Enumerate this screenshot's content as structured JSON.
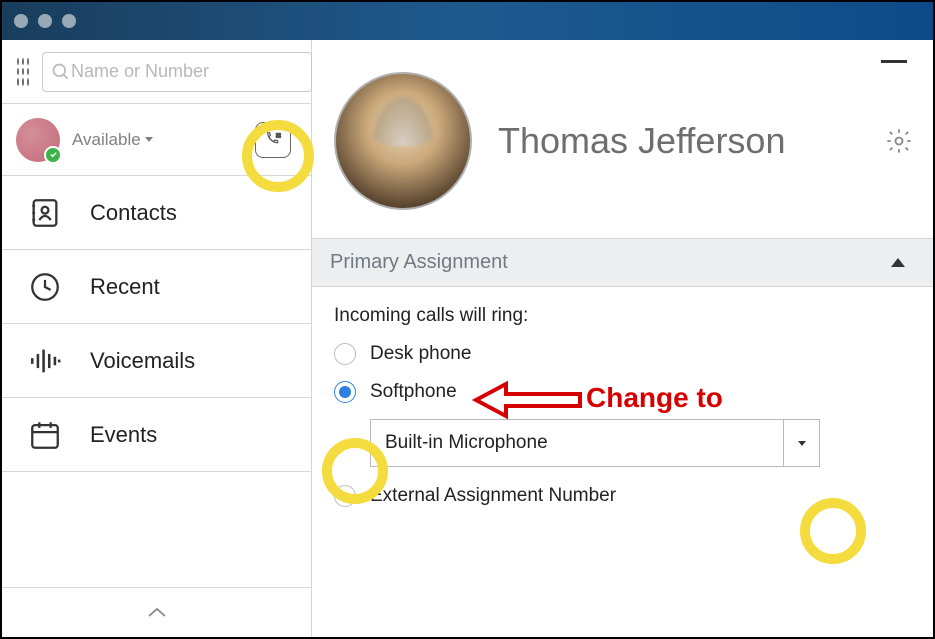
{
  "header": {
    "search_placeholder": "Name or Number"
  },
  "status": {
    "label": "Available"
  },
  "nav": {
    "contacts": "Contacts",
    "recent": "Recent",
    "voicemails": "Voicemails",
    "events": "Events"
  },
  "contact": {
    "name": "Thomas Jefferson"
  },
  "section": {
    "primary_assignment": "Primary Assignment",
    "incoming_label": "Incoming calls will ring:",
    "options": {
      "desk_phone": "Desk phone",
      "softphone": "Softphone",
      "external": "External Assignment Number"
    },
    "mic_device": "Built-in Microphone"
  },
  "annotation": {
    "text": "Change to"
  }
}
